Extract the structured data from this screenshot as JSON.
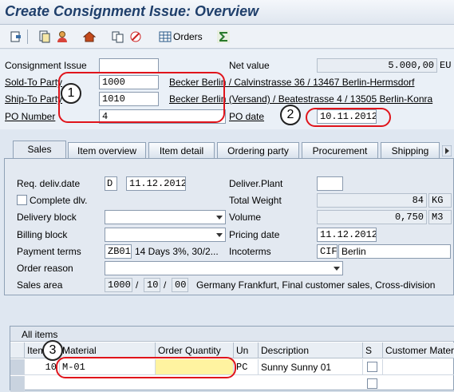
{
  "window": {
    "title": "Create Consignment Issue: Overview"
  },
  "toolbar": {
    "orders_label": "Orders"
  },
  "header": {
    "consignment_issue_label": "Consignment Issue",
    "consignment_issue_value": "",
    "net_value_label": "Net value",
    "net_value": "5.000,00",
    "currency": "EU",
    "sold_to_label": "Sold-To Party",
    "sold_to_value": "1000",
    "sold_to_desc": "Becker Berlin / Calvinstrasse 36 / 13467 Berlin-Hermsdorf",
    "ship_to_label": "Ship-To Party",
    "ship_to_value": "1010",
    "ship_to_desc": "Becker Berlin (Versand) / Beatestrasse 4 / 13505 Berlin-Konra",
    "po_number_label": "PO Number",
    "po_number_value": "4",
    "po_date_label": "PO date",
    "po_date_value": "10.11.2012"
  },
  "tabs": [
    {
      "label": "Sales"
    },
    {
      "label": "Item overview"
    },
    {
      "label": "Item detail"
    },
    {
      "label": "Ordering party"
    },
    {
      "label": "Procurement"
    },
    {
      "label": "Shipping"
    }
  ],
  "sales": {
    "req_deliv_label": "Req. deliv.date",
    "req_deliv_type": "D",
    "req_deliv_value": "11.12.2012",
    "deliver_plant_label": "Deliver.Plant",
    "deliver_plant_value": "",
    "complete_dlv_label": "Complete dlv.",
    "total_weight_label": "Total Weight",
    "total_weight_value": "84",
    "total_weight_unit": "KG",
    "delivery_block_label": "Delivery block",
    "volume_label": "Volume",
    "volume_value": "0,750",
    "volume_unit": "M3",
    "billing_block_label": "Billing block",
    "pricing_date_label": "Pricing date",
    "pricing_date_value": "11.12.2012",
    "payment_terms_label": "Payment terms",
    "payment_terms_value": "ZB01",
    "payment_terms_desc": "14 Days 3%, 30/2...",
    "incoterms_label": "Incoterms",
    "incoterms_value": "CIF",
    "incoterms_place": "Berlin",
    "order_reason_label": "Order reason",
    "sales_area_label": "Sales area",
    "sales_org": "1000",
    "distr_channel": "10",
    "division": "00",
    "sales_area_desc": "Germany Frankfurt, Final customer sales, Cross-division"
  },
  "items": {
    "title": "All items",
    "columns": [
      "Item",
      "Material",
      "Order Quantity",
      "Un",
      "Description",
      "S",
      "Customer Mater"
    ],
    "rows": [
      {
        "item": "10",
        "material": "M-01",
        "quantity": "",
        "unit": "PC",
        "description": "Sunny Sunny 01"
      }
    ]
  },
  "annotations": {
    "one": "1",
    "two": "2",
    "three": "3"
  },
  "colors": {
    "annotation_red": "#e0141b",
    "title_blue": "#1f3f6b",
    "highlight_yellow": "#fff3a0"
  }
}
